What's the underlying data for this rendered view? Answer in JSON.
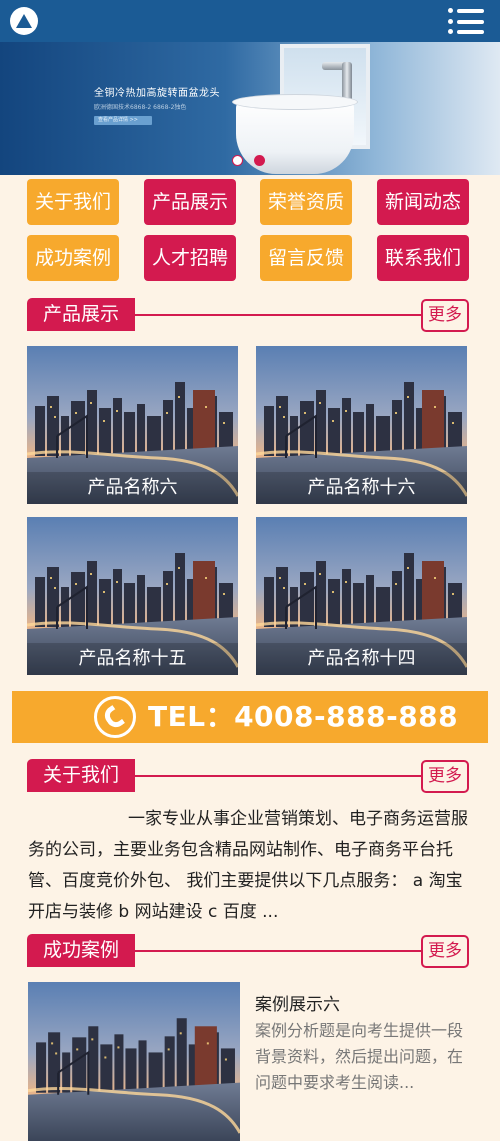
{
  "banner": {
    "title": "全铜冷热加高旋转面盆龙头",
    "subtitle": "欧洲德国技术6868-2 6868-2独色",
    "button": "查看产品详情 >>"
  },
  "nav": [
    {
      "label": "关于我们",
      "color": "#f7a92d"
    },
    {
      "label": "产品展示",
      "color": "#d31a4f"
    },
    {
      "label": "荣誉资质",
      "color": "#f7a92d"
    },
    {
      "label": "新闻动态",
      "color": "#d31a4f"
    },
    {
      "label": "成功案例",
      "color": "#f7a92d"
    },
    {
      "label": "人才招聘",
      "color": "#d31a4f"
    },
    {
      "label": "留言反馈",
      "color": "#f7a92d"
    },
    {
      "label": "联系我们",
      "color": "#d31a4f"
    }
  ],
  "products": {
    "title": "产品展示",
    "more": "更多",
    "items": [
      {
        "name": "产品名称六"
      },
      {
        "name": "产品名称十六"
      },
      {
        "name": "产品名称十五"
      },
      {
        "name": "产品名称十四"
      }
    ]
  },
  "tel": {
    "text": "TEL：4008-888-888"
  },
  "about": {
    "title": "关于我们",
    "more": "更多",
    "text": "一家专业从事企业营销策划、电子商务运营服务的公司，主要业务包含精品网站制作、电子商务平台托管、百度竞价外包、 我们主要提供以下几点服务： a 淘宝开店与装修 b 网站建设 c 百度 ..."
  },
  "cases": {
    "title": "成功案例",
    "more": "更多",
    "item": {
      "title": "案例展示六",
      "desc": "案例分析题是向考生提供一段背景资料，然后提出问题，在问题中要求考生阅读..."
    }
  },
  "colors": {
    "header": "#1b5b95",
    "accent_red": "#d31a4f",
    "accent_orange": "#f7a92d",
    "page_bg": "#fdf3e6"
  }
}
